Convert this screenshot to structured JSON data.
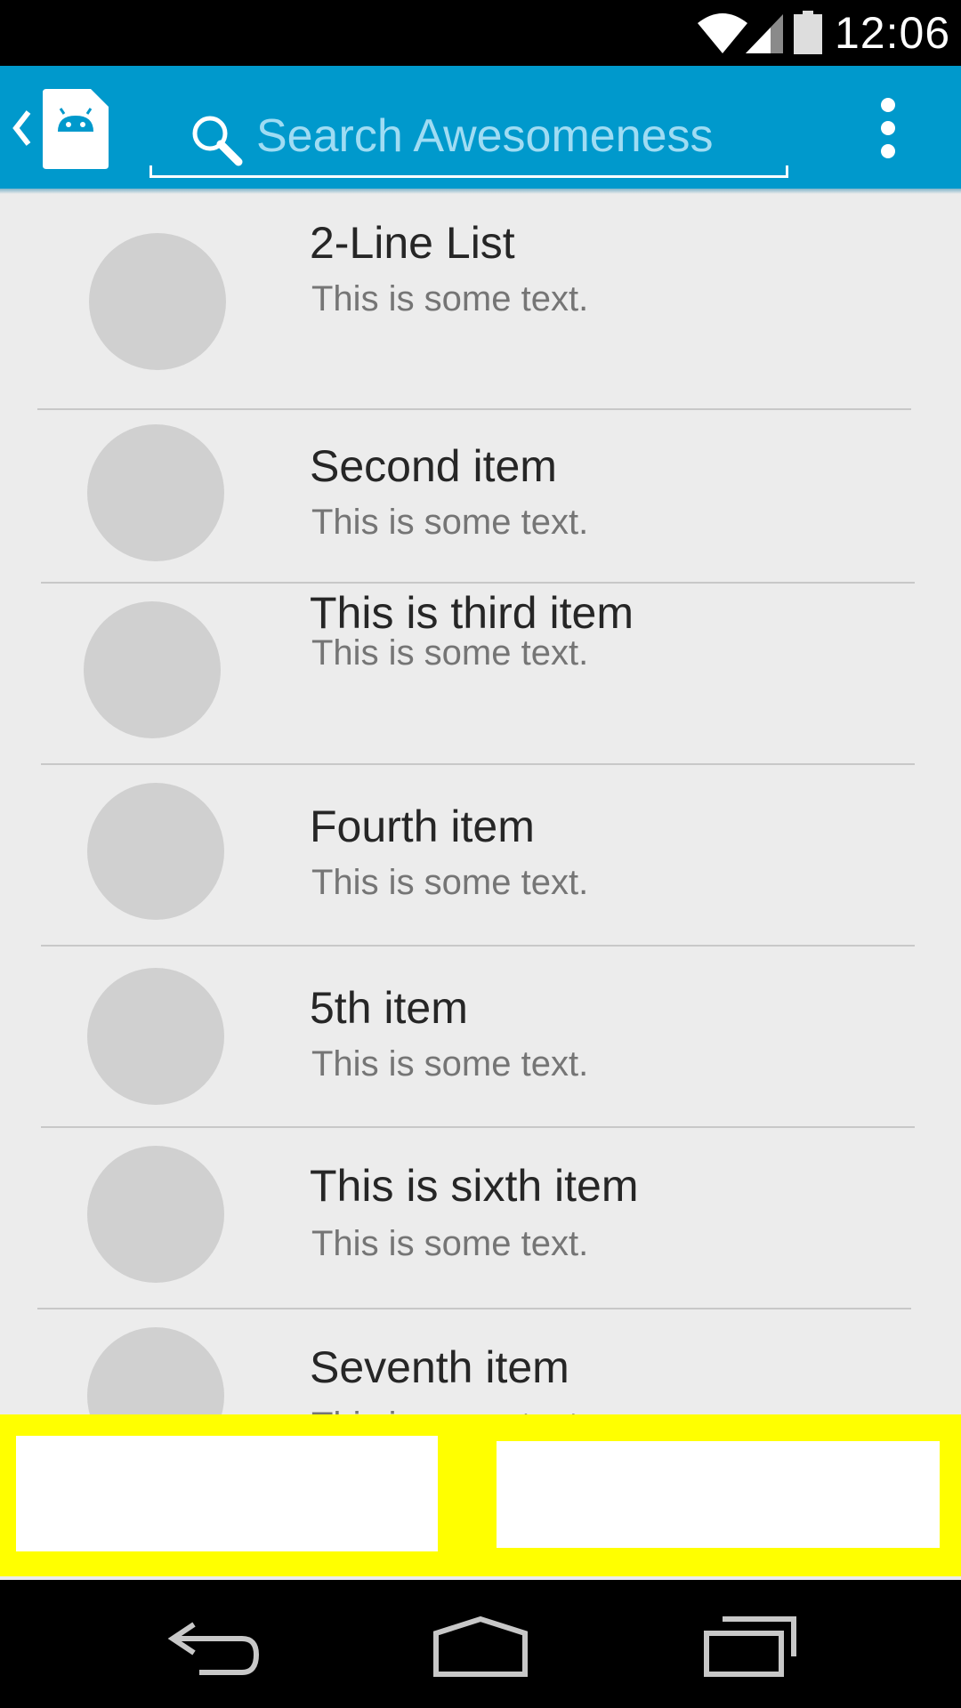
{
  "status_bar": {
    "time": "12:06",
    "icons": [
      "wifi-icon",
      "cell-signal-icon",
      "battery-icon"
    ]
  },
  "action_bar": {
    "up_icon": "chevron-left-icon",
    "app_icon": "android-app-icon",
    "search": {
      "placeholder": "Search Awesomeness",
      "value": "",
      "icon": "search-icon"
    },
    "overflow_icon": "overflow-menu-icon",
    "color": "#0099cc"
  },
  "list": {
    "items": [
      {
        "title": "2-Line List",
        "subtitle": "This is some text."
      },
      {
        "title": "Second item",
        "subtitle": "This is some text."
      },
      {
        "title": "This is third item",
        "subtitle": "This is some text."
      },
      {
        "title": "Fourth item",
        "subtitle": "This is some text."
      },
      {
        "title": "5th item",
        "subtitle": "This is some text."
      },
      {
        "title": "This is sixth item",
        "subtitle": "This is some text."
      },
      {
        "title": "Seventh item",
        "subtitle": "This is some text."
      }
    ]
  },
  "button_bar": {
    "color": "#ffff00",
    "left_button_label": "",
    "right_button_label": ""
  },
  "nav_bar": {
    "icons": [
      "back-icon",
      "home-icon",
      "recent-apps-icon"
    ]
  }
}
